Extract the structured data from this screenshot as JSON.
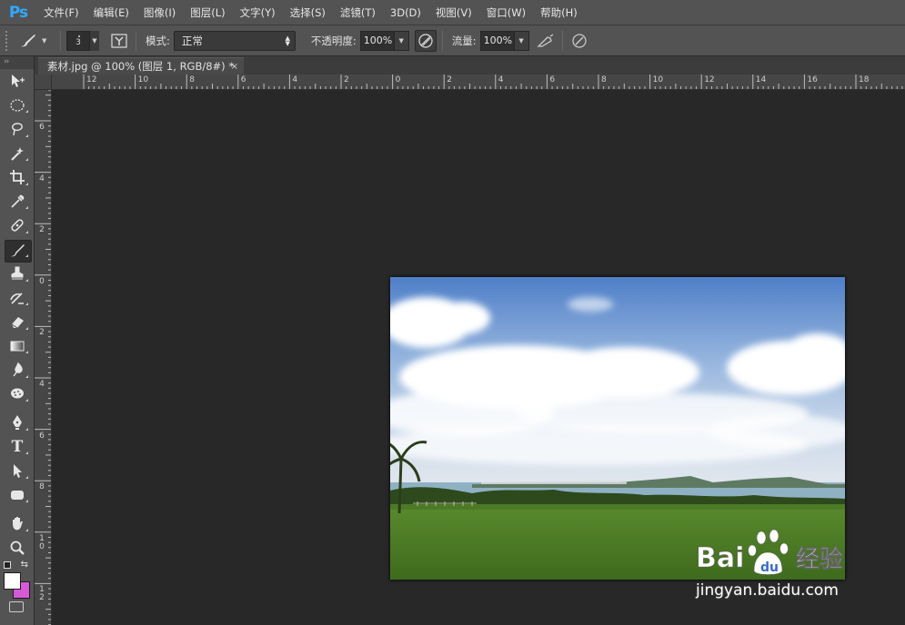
{
  "app": {
    "logo": "Ps"
  },
  "menu": [
    "文件(F)",
    "编辑(E)",
    "图像(I)",
    "图层(L)",
    "文字(Y)",
    "选择(S)",
    "滤镜(T)",
    "3D(D)",
    "视图(V)",
    "窗口(W)",
    "帮助(H)"
  ],
  "options": {
    "brush_size": "3",
    "mode_label": "模式:",
    "mode_value": "正常",
    "opacity_label": "不透明度:",
    "opacity_value": "100%",
    "flow_label": "流量:",
    "flow_value": "100%"
  },
  "document_tab": {
    "title": "素材.jpg @ 100% (图层 1, RGB/8#) *",
    "close": "×"
  },
  "ruler_top": [
    "12",
    "10",
    "8",
    "6",
    "4",
    "2",
    "0",
    "2",
    "4",
    "6",
    "8",
    "10",
    "12",
    "14",
    "16",
    "18"
  ],
  "ruler_left": [
    "6",
    "4",
    "2",
    "0",
    "2",
    "4",
    "6",
    "8",
    "10",
    "12"
  ],
  "toolbar": {
    "tools": [
      "move-tool",
      "elliptical-marquee-tool",
      "lasso-tool",
      "magic-wand-tool",
      "crop-tool",
      "eyedropper-tool",
      "healing-brush-tool",
      "brush-tool",
      "clone-stamp-tool",
      "history-brush-tool",
      "eraser-tool",
      "gradient-tool",
      "blur-tool",
      "dodge-tool",
      "pen-tool",
      "type-tool",
      "path-selection-tool",
      "rectangle-tool",
      "hand-tool",
      "zoom-tool"
    ],
    "active_tool": "brush-tool",
    "type_tool_glyph": "T"
  },
  "colors": {
    "foreground": "#ffffff",
    "background": "#d65ad8"
  },
  "watermark": {
    "brand": "Bai 经验",
    "url": "jingyan.baidu.com"
  }
}
